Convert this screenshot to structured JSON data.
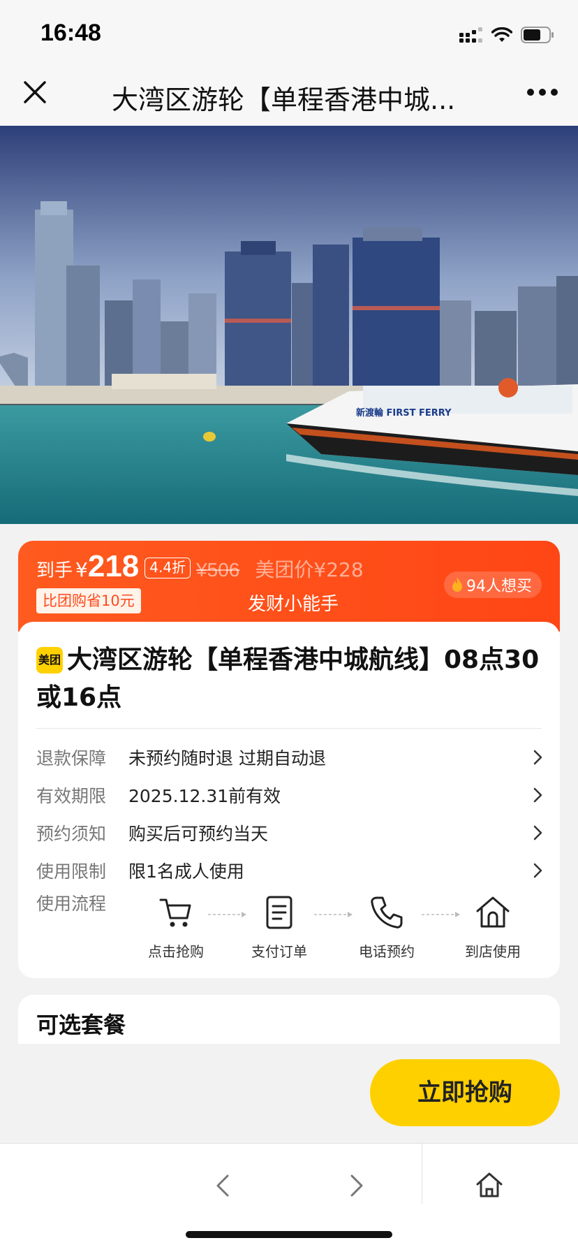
{
  "status_bar": {
    "time": "16:48"
  },
  "nav": {
    "title": "大湾区游轮【单程香港中城..."
  },
  "hero": {
    "ship_label": "新渡輪 FIRST FERRY"
  },
  "price_banner": {
    "daoshou": "到手",
    "yen": "¥",
    "price": "218",
    "discount": "4.4折",
    "original": "¥506",
    "meituan_price": "美团价¥228",
    "save_tag": "比团购省10元",
    "seller": "发财小能手",
    "want_count": "94人想买",
    "color": "#ff4b1c"
  },
  "product": {
    "badge": "美团",
    "title": "大湾区游轮【单程香港中城航线】08点30或16点"
  },
  "info_rows": [
    {
      "label": "退款保障",
      "value": "未预约随时退 过期自动退"
    },
    {
      "label": "有效期限",
      "value": "2025.12.31前有效"
    },
    {
      "label": "预约须知",
      "value": "购买后可预约当天"
    },
    {
      "label": "使用限制",
      "value": "限1名成人使用"
    }
  ],
  "flow": {
    "label": "使用流程",
    "steps": [
      {
        "icon": "cart-icon",
        "label": "点击抢购"
      },
      {
        "icon": "document-icon",
        "label": "支付订单"
      },
      {
        "icon": "phone-icon",
        "label": "电话预约"
      },
      {
        "icon": "store-icon",
        "label": "到店使用"
      }
    ]
  },
  "packages": {
    "title": "可选套餐"
  },
  "buy_button": {
    "label": "立即抢购",
    "color": "#ffd000"
  }
}
